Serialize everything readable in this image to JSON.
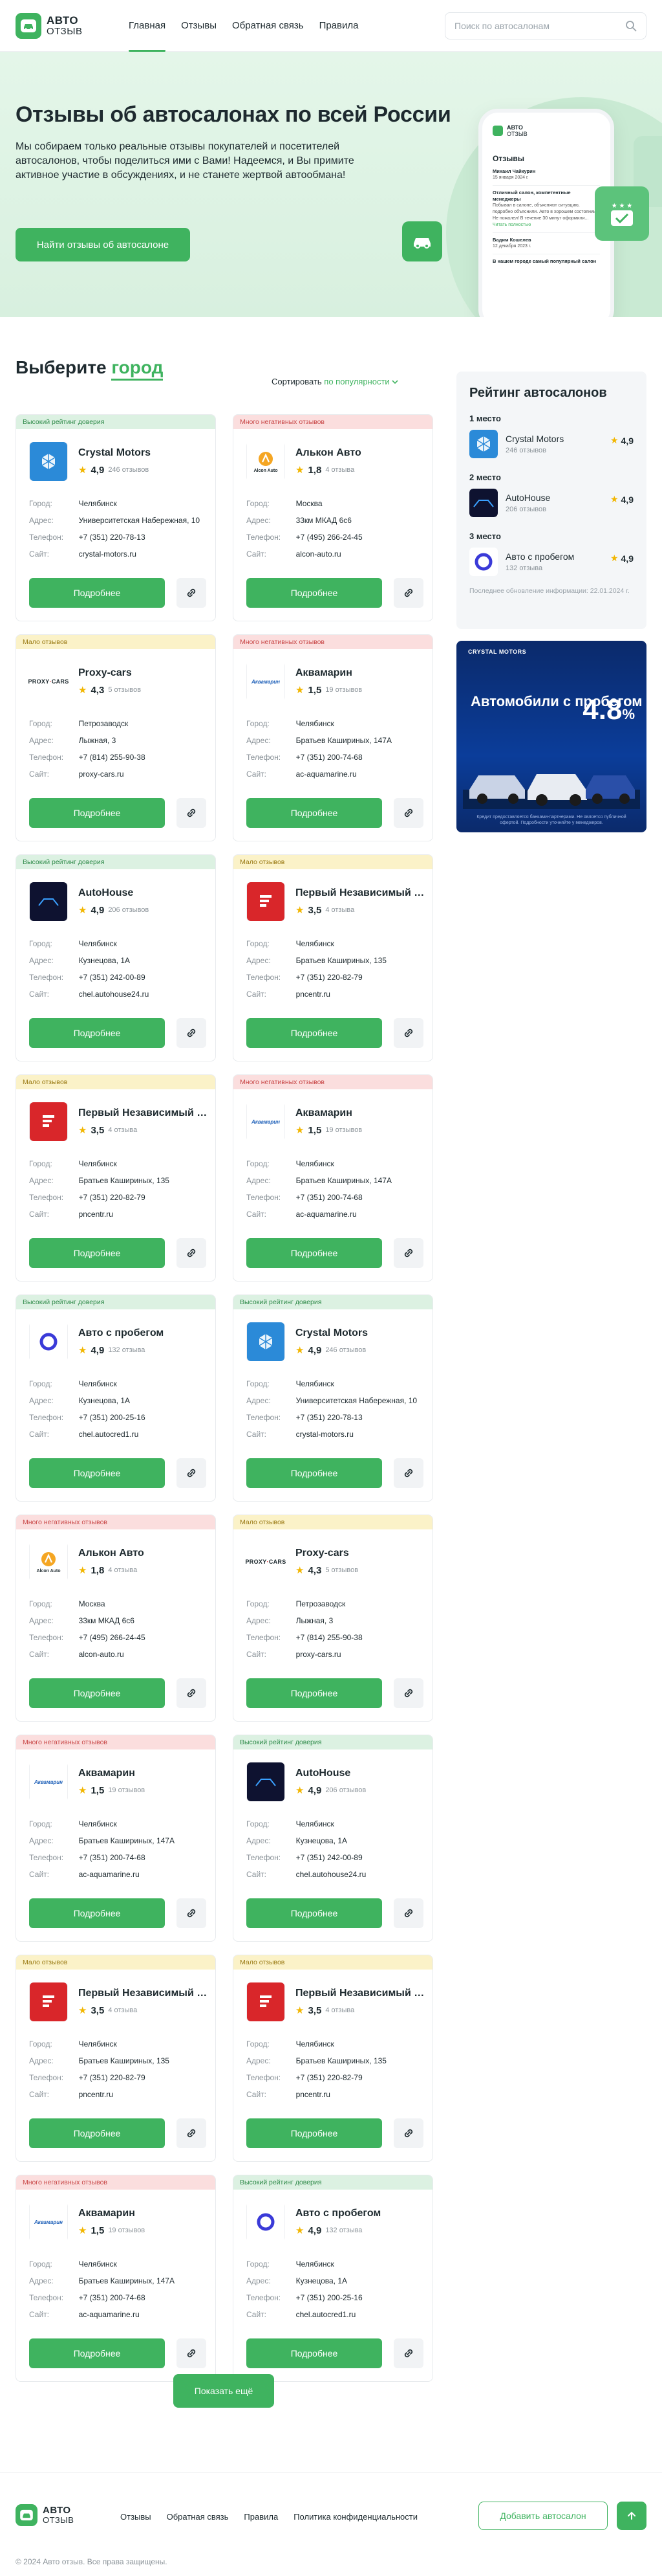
{
  "brand": {
    "line1": "АВТО",
    "line2": "ОТЗЫВ"
  },
  "nav": [
    {
      "label": "Главная",
      "active": true
    },
    {
      "label": "Отзывы",
      "active": false
    },
    {
      "label": "Обратная связь",
      "active": false
    },
    {
      "label": "Правила",
      "active": false
    }
  ],
  "search": {
    "placeholder": "Поиск по автосалонам"
  },
  "hero": {
    "title": "Отзывы об автосалонах по всей России",
    "subtitle": "Мы собираем только реальные отзывы покупателей и посетителей автосалонов, чтобы поделиться ими с Вами! Надеемся, и Вы примите активное участие в обсуждениях, и не станете жертвой автообмана!",
    "cta": "Найти отзывы об автосалоне",
    "phone": {
      "title": "Отзывы",
      "reviews": [
        {
          "author": "Михаил Чайкурин",
          "date": "15 января 2024 г.",
          "title": "Отличный салон, компетентные менеджеры",
          "text": "Побывал в салоне, объясняют ситуацию, подробно объяснили. Авто в хорошем состоянии. Не пожалел! В течение 30 минут оформили..."
        },
        {
          "author": "Вадим Кошелев",
          "date": "12 декабря 2023 г.",
          "title": "В нашем городе самый популярный салон",
          "text": ""
        }
      ],
      "more": "Читать полностью"
    }
  },
  "section": {
    "title_prefix": "Выберите",
    "title_accent": "город",
    "sort_prefix": "Сортировать",
    "sort_value": "по популярности"
  },
  "labels": {
    "city": "Город:",
    "address": "Адрес:",
    "phone": "Телефон:",
    "site": "Сайт:",
    "details": "Подробнее",
    "reviews_suffix": "отзывов"
  },
  "cards": [
    {
      "tag": "Высокий рейтинг доверия",
      "tone": "green",
      "name": "Crystal Motors",
      "rating": "4,9",
      "reviews": "246 отзывов",
      "city": "Челябинск",
      "address": "Университетская Набережная, 10",
      "phone": "+7 (351) 220-78-13",
      "site": "crystal-motors.ru",
      "logo": "crystal"
    },
    {
      "tag": "Много негативных отзывов",
      "tone": "red",
      "name": "Алькон Авто",
      "rating": "1,8",
      "reviews": "4 отзыва",
      "city": "Москва",
      "address": "33км МКАД 6с6",
      "phone": "+7 (495) 266-24-45",
      "site": "alcon-auto.ru",
      "logo": "alcon"
    },
    {
      "tag": "Мало отзывов",
      "tone": "yellow",
      "name": "Proxy-cars",
      "rating": "4,3",
      "reviews": "5 отзывов",
      "city": "Петрозаводск",
      "address": "Лыжная, 3",
      "phone": "+7 (814) 255-90-38",
      "site": "proxy-cars.ru",
      "logo": "proxy"
    },
    {
      "tag": "Много негативных отзывов",
      "tone": "red",
      "name": "Аквамарин",
      "rating": "1,5",
      "reviews": "19 отзывов",
      "city": "Челябинск",
      "address": "Братьев Кашириных, 147А",
      "phone": "+7 (351) 200-74-68",
      "site": "ac-aquamarine.ru",
      "logo": "aqua"
    },
    {
      "tag": "Высокий рейтинг доверия",
      "tone": "green",
      "name": "AutoHouse",
      "rating": "4,9",
      "reviews": "206 отзывов",
      "city": "Челябинск",
      "address": "Кузнецова, 1А",
      "phone": "+7 (351) 242-00-89",
      "site": "chel.autohouse24.ru",
      "logo": "autohouse"
    },
    {
      "tag": "Мало отзывов",
      "tone": "yellow",
      "name": "Первый Независимый Центр",
      "rating": "3,5",
      "reviews": "4 отзыва",
      "city": "Челябинск",
      "address": "Братьев Кашириных, 135",
      "phone": "+7 (351) 220-82-79",
      "site": "pncentr.ru",
      "logo": "pnc"
    },
    {
      "tag": "Мало отзывов",
      "tone": "yellow",
      "name": "Первый Независимый Центр",
      "rating": "3,5",
      "reviews": "4 отзыва",
      "city": "Челябинск",
      "address": "Братьев Кашириных, 135",
      "phone": "+7 (351) 220-82-79",
      "site": "pncentr.ru",
      "logo": "pnc"
    },
    {
      "tag": "Много негативных отзывов",
      "tone": "red",
      "name": "Аквамарин",
      "rating": "1,5",
      "reviews": "19 отзывов",
      "city": "Челябинск",
      "address": "Братьев Кашириных, 147А",
      "phone": "+7 (351) 200-74-68",
      "site": "ac-aquamarine.ru",
      "logo": "aqua"
    },
    {
      "tag": "Высокий рейтинг доверия",
      "tone": "green",
      "name": "Авто с пробегом",
      "rating": "4,9",
      "reviews": "132 отзыва",
      "city": "Челябинск",
      "address": "Кузнецова, 1А",
      "phone": "+7 (351) 200-25-16",
      "site": "chel.autocred1.ru",
      "logo": "probeg"
    },
    {
      "tag": "Высокий рейтинг доверия",
      "tone": "green",
      "name": "Crystal Motors",
      "rating": "4,9",
      "reviews": "246 отзывов",
      "city": "Челябинск",
      "address": "Университетская Набережная, 10",
      "phone": "+7 (351) 220-78-13",
      "site": "crystal-motors.ru",
      "logo": "crystal"
    },
    {
      "tag": "Много негативных отзывов",
      "tone": "red",
      "name": "Алькон Авто",
      "rating": "1,8",
      "reviews": "4 отзыва",
      "city": "Москва",
      "address": "33км МКАД 6с6",
      "phone": "+7 (495) 266-24-45",
      "site": "alcon-auto.ru",
      "logo": "alcon"
    },
    {
      "tag": "Мало отзывов",
      "tone": "yellow",
      "name": "Proxy-cars",
      "rating": "4,3",
      "reviews": "5 отзывов",
      "city": "Петрозаводск",
      "address": "Лыжная, 3",
      "phone": "+7 (814) 255-90-38",
      "site": "proxy-cars.ru",
      "logo": "proxy"
    },
    {
      "tag": "Много негативных отзывов",
      "tone": "red",
      "name": "Аквамарин",
      "rating": "1,5",
      "reviews": "19 отзывов",
      "city": "Челябинск",
      "address": "Братьев Кашириных, 147А",
      "phone": "+7 (351) 200-74-68",
      "site": "ac-aquamarine.ru",
      "logo": "aqua"
    },
    {
      "tag": "Высокий рейтинг доверия",
      "tone": "green",
      "name": "AutoHouse",
      "rating": "4,9",
      "reviews": "206 отзывов",
      "city": "Челябинск",
      "address": "Кузнецова, 1А",
      "phone": "+7 (351) 242-00-89",
      "site": "chel.autohouse24.ru",
      "logo": "autohouse"
    },
    {
      "tag": "Мало отзывов",
      "tone": "yellow",
      "name": "Первый Независимый Центр",
      "rating": "3,5",
      "reviews": "4 отзыва",
      "city": "Челябинск",
      "address": "Братьев Кашириных, 135",
      "phone": "+7 (351) 220-82-79",
      "site": "pncentr.ru",
      "logo": "pnc"
    },
    {
      "tag": "Мало отзывов",
      "tone": "yellow",
      "name": "Первый Независимый Центр",
      "rating": "3,5",
      "reviews": "4 отзыва",
      "city": "Челябинск",
      "address": "Братьев Кашириных, 135",
      "phone": "+7 (351) 220-82-79",
      "site": "pncentr.ru",
      "logo": "pnc"
    },
    {
      "tag": "Много негативных отзывов",
      "tone": "red",
      "name": "Аквамарин",
      "rating": "1,5",
      "reviews": "19 отзывов",
      "city": "Челябинск",
      "address": "Братьев Кашириных, 147А",
      "phone": "+7 (351) 200-74-68",
      "site": "ac-aquamarine.ru",
      "logo": "aqua"
    },
    {
      "tag": "Высокий рейтинг доверия",
      "tone": "green",
      "name": "Авто с пробегом",
      "rating": "4,9",
      "reviews": "132 отзыва",
      "city": "Челябинск",
      "address": "Кузнецова, 1А",
      "phone": "+7 (351) 200-25-16",
      "site": "chel.autocred1.ru",
      "logo": "probeg"
    }
  ],
  "sidebar": {
    "title": "Рейтинг автосалонов",
    "places": [
      {
        "place": "1 место",
        "name": "Crystal Motors",
        "count": "246 отзывов",
        "score": "4,9",
        "logo": "crystal"
      },
      {
        "place": "2 место",
        "name": "AutoHouse",
        "count": "206 отзывов",
        "score": "4,9",
        "logo": "autohouse"
      },
      {
        "place": "3 место",
        "name": "Авто с пробегом",
        "count": "132 отзыва",
        "score": "4,9",
        "logo": "probeg"
      }
    ],
    "updated": "Последнее обновление информации: 22.01.2024 г."
  },
  "promo": {
    "badge": "CRYSTAL MOTORS",
    "title": "Автомобили с пробегом",
    "rate": "4.8",
    "rate_unit": "%",
    "foot": "Кредит предоставляется банками-партнерами. Не является публичной офертой. Подробности уточняйте у менеджеров."
  },
  "show_more": "Показать ещё",
  "footer": {
    "links": [
      "Отзывы",
      "Обратная связь",
      "Правила",
      "Политика конфиденциальности"
    ],
    "add_button": "Добавить автосалон",
    "copyright": "© 2024 Авто отзыв. Все права защищены."
  },
  "colors": {
    "accent": "#3fb35f",
    "green_tag": "#dcf1e2",
    "red_tag": "#fbdede",
    "yellow_tag": "#fbf2c8",
    "star": "#f2b600"
  }
}
